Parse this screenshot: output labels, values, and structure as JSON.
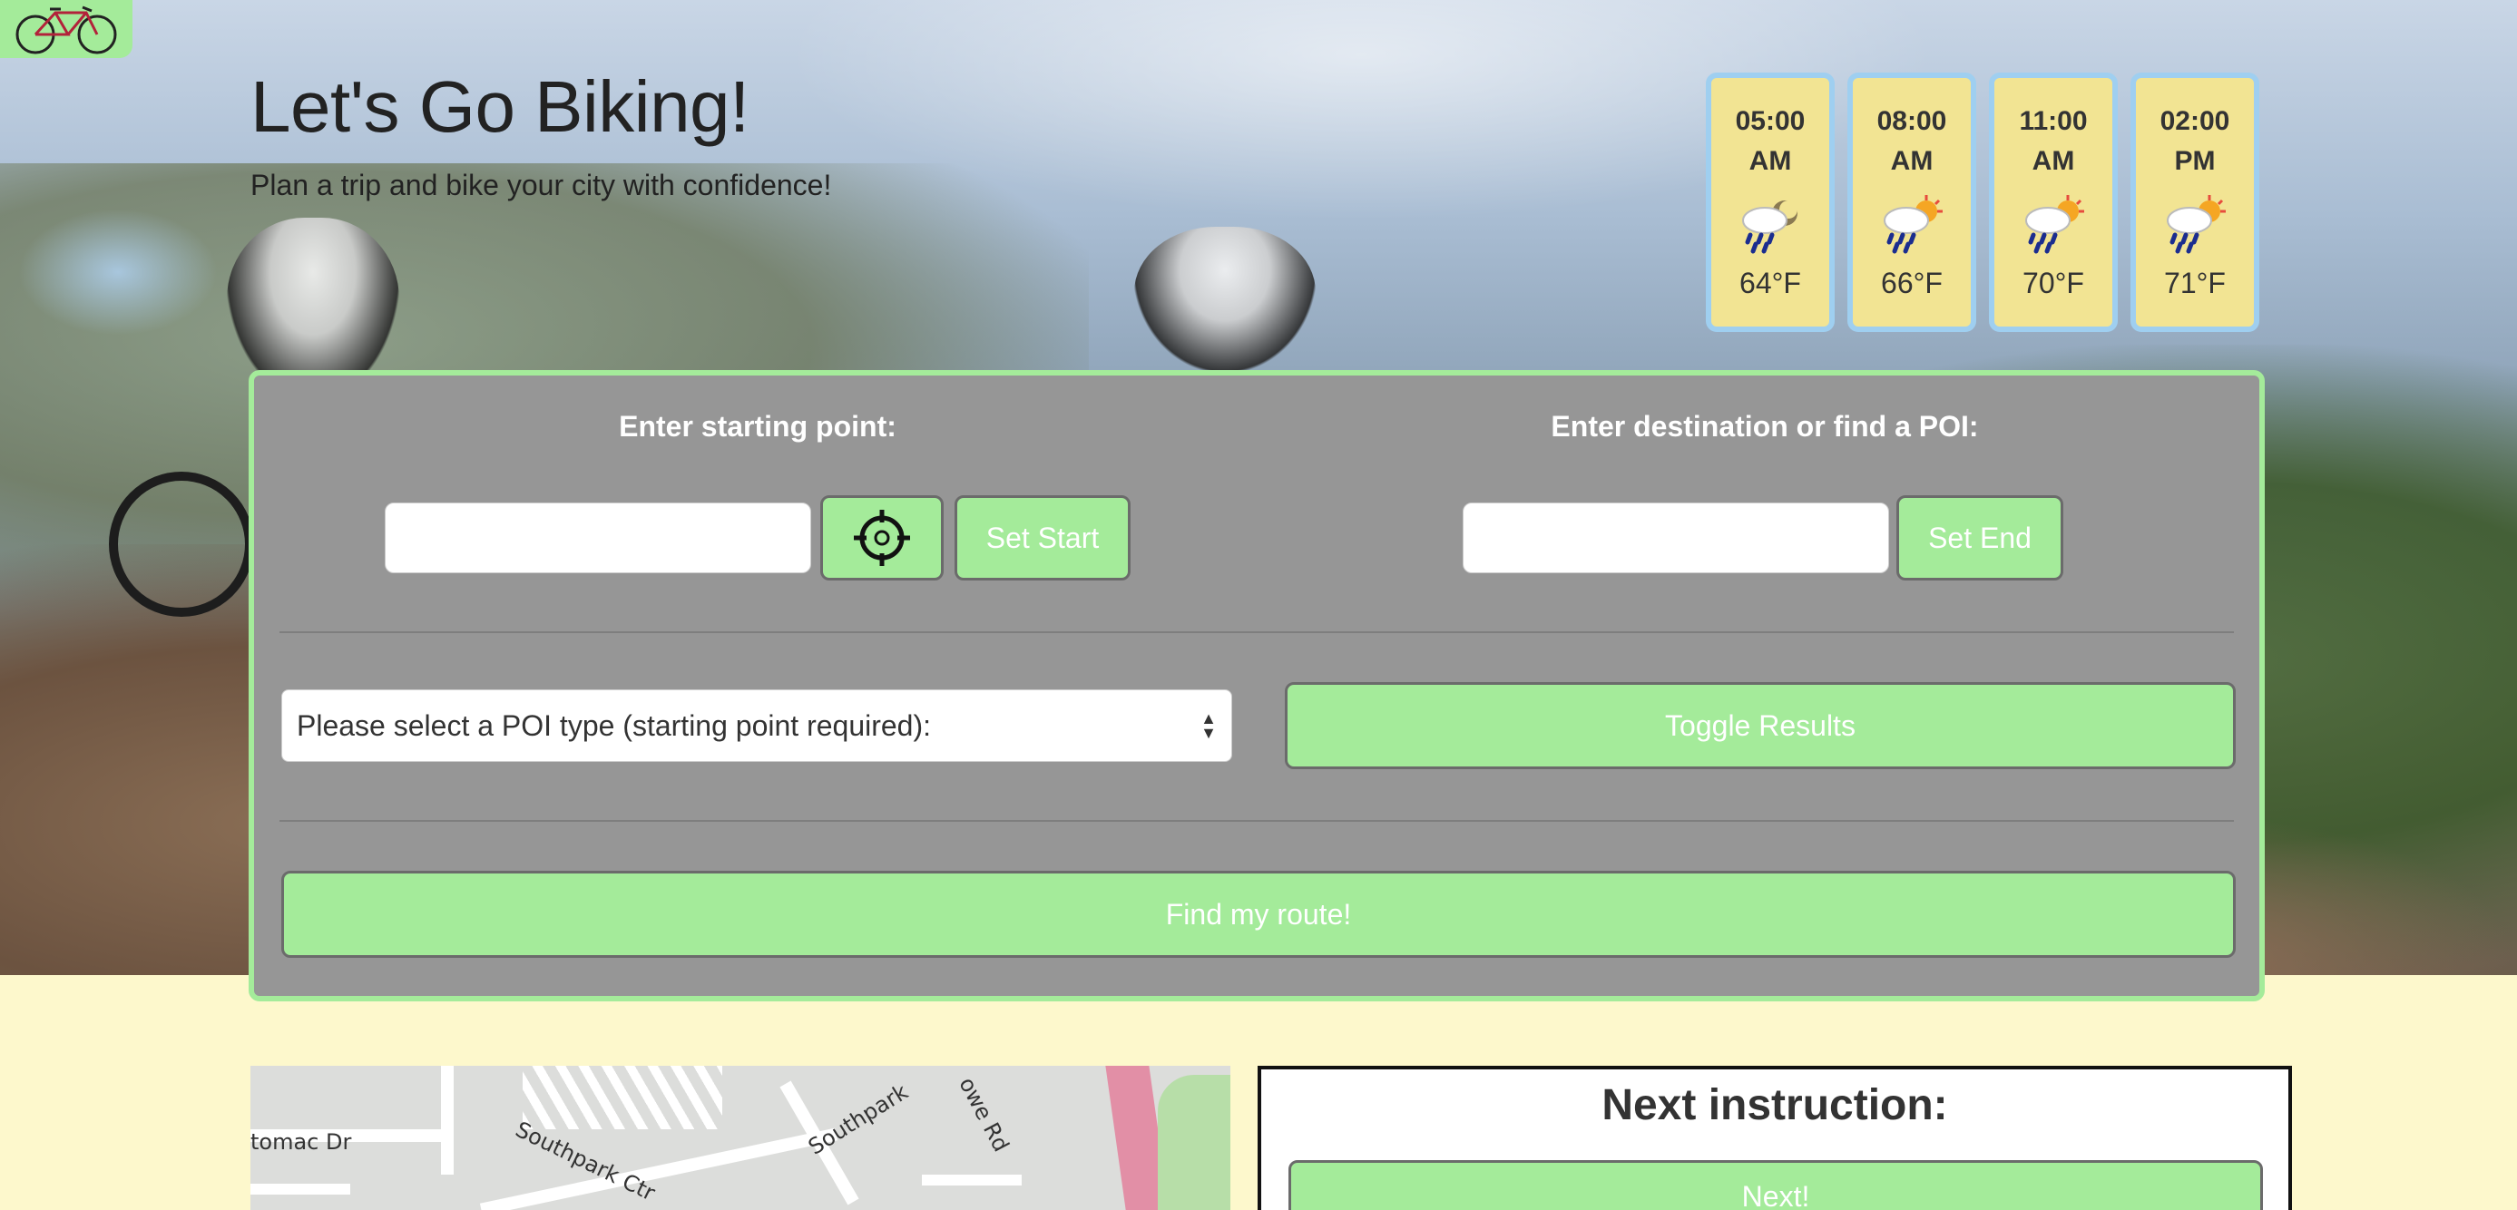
{
  "header": {
    "title": "Let's Go Biking!",
    "subtitle": "Plan a trip and bike your city with confidence!"
  },
  "logo": {
    "icon": "bicycle-icon"
  },
  "weather": [
    {
      "time": "05:00",
      "period": "AM",
      "temp": "64°F",
      "icon": "rain-cloud-moon-icon"
    },
    {
      "time": "08:00",
      "period": "AM",
      "temp": "66°F",
      "icon": "rain-cloud-sun-icon"
    },
    {
      "time": "11:00",
      "period": "AM",
      "temp": "70°F",
      "icon": "rain-cloud-sun-icon"
    },
    {
      "time": "02:00",
      "period": "PM",
      "temp": "71°F",
      "icon": "rain-cloud-sun-icon"
    }
  ],
  "form": {
    "start_label": "Enter starting point:",
    "start_value": "",
    "locate_icon": "crosshair-icon",
    "set_start": "Set Start",
    "end_label": "Enter destination or find a POI:",
    "end_value": "",
    "set_end": "Set End",
    "poi_select": "Please select a POI type (starting point required):",
    "toggle_results": "Toggle Results",
    "find_route": "Find my route!"
  },
  "map": {
    "labels": [
      "tomac Dr",
      "Southpark Ctr",
      "Southpark",
      "owe Rd"
    ]
  },
  "instruction": {
    "heading": "Next instruction:",
    "next_button": "Next!"
  },
  "colors": {
    "accent_green": "#a4eb9a",
    "panel_gray": "#969696",
    "page_bg": "#fdf8cc",
    "weather_card": "#f2e493",
    "weather_border": "#9fcff0"
  }
}
